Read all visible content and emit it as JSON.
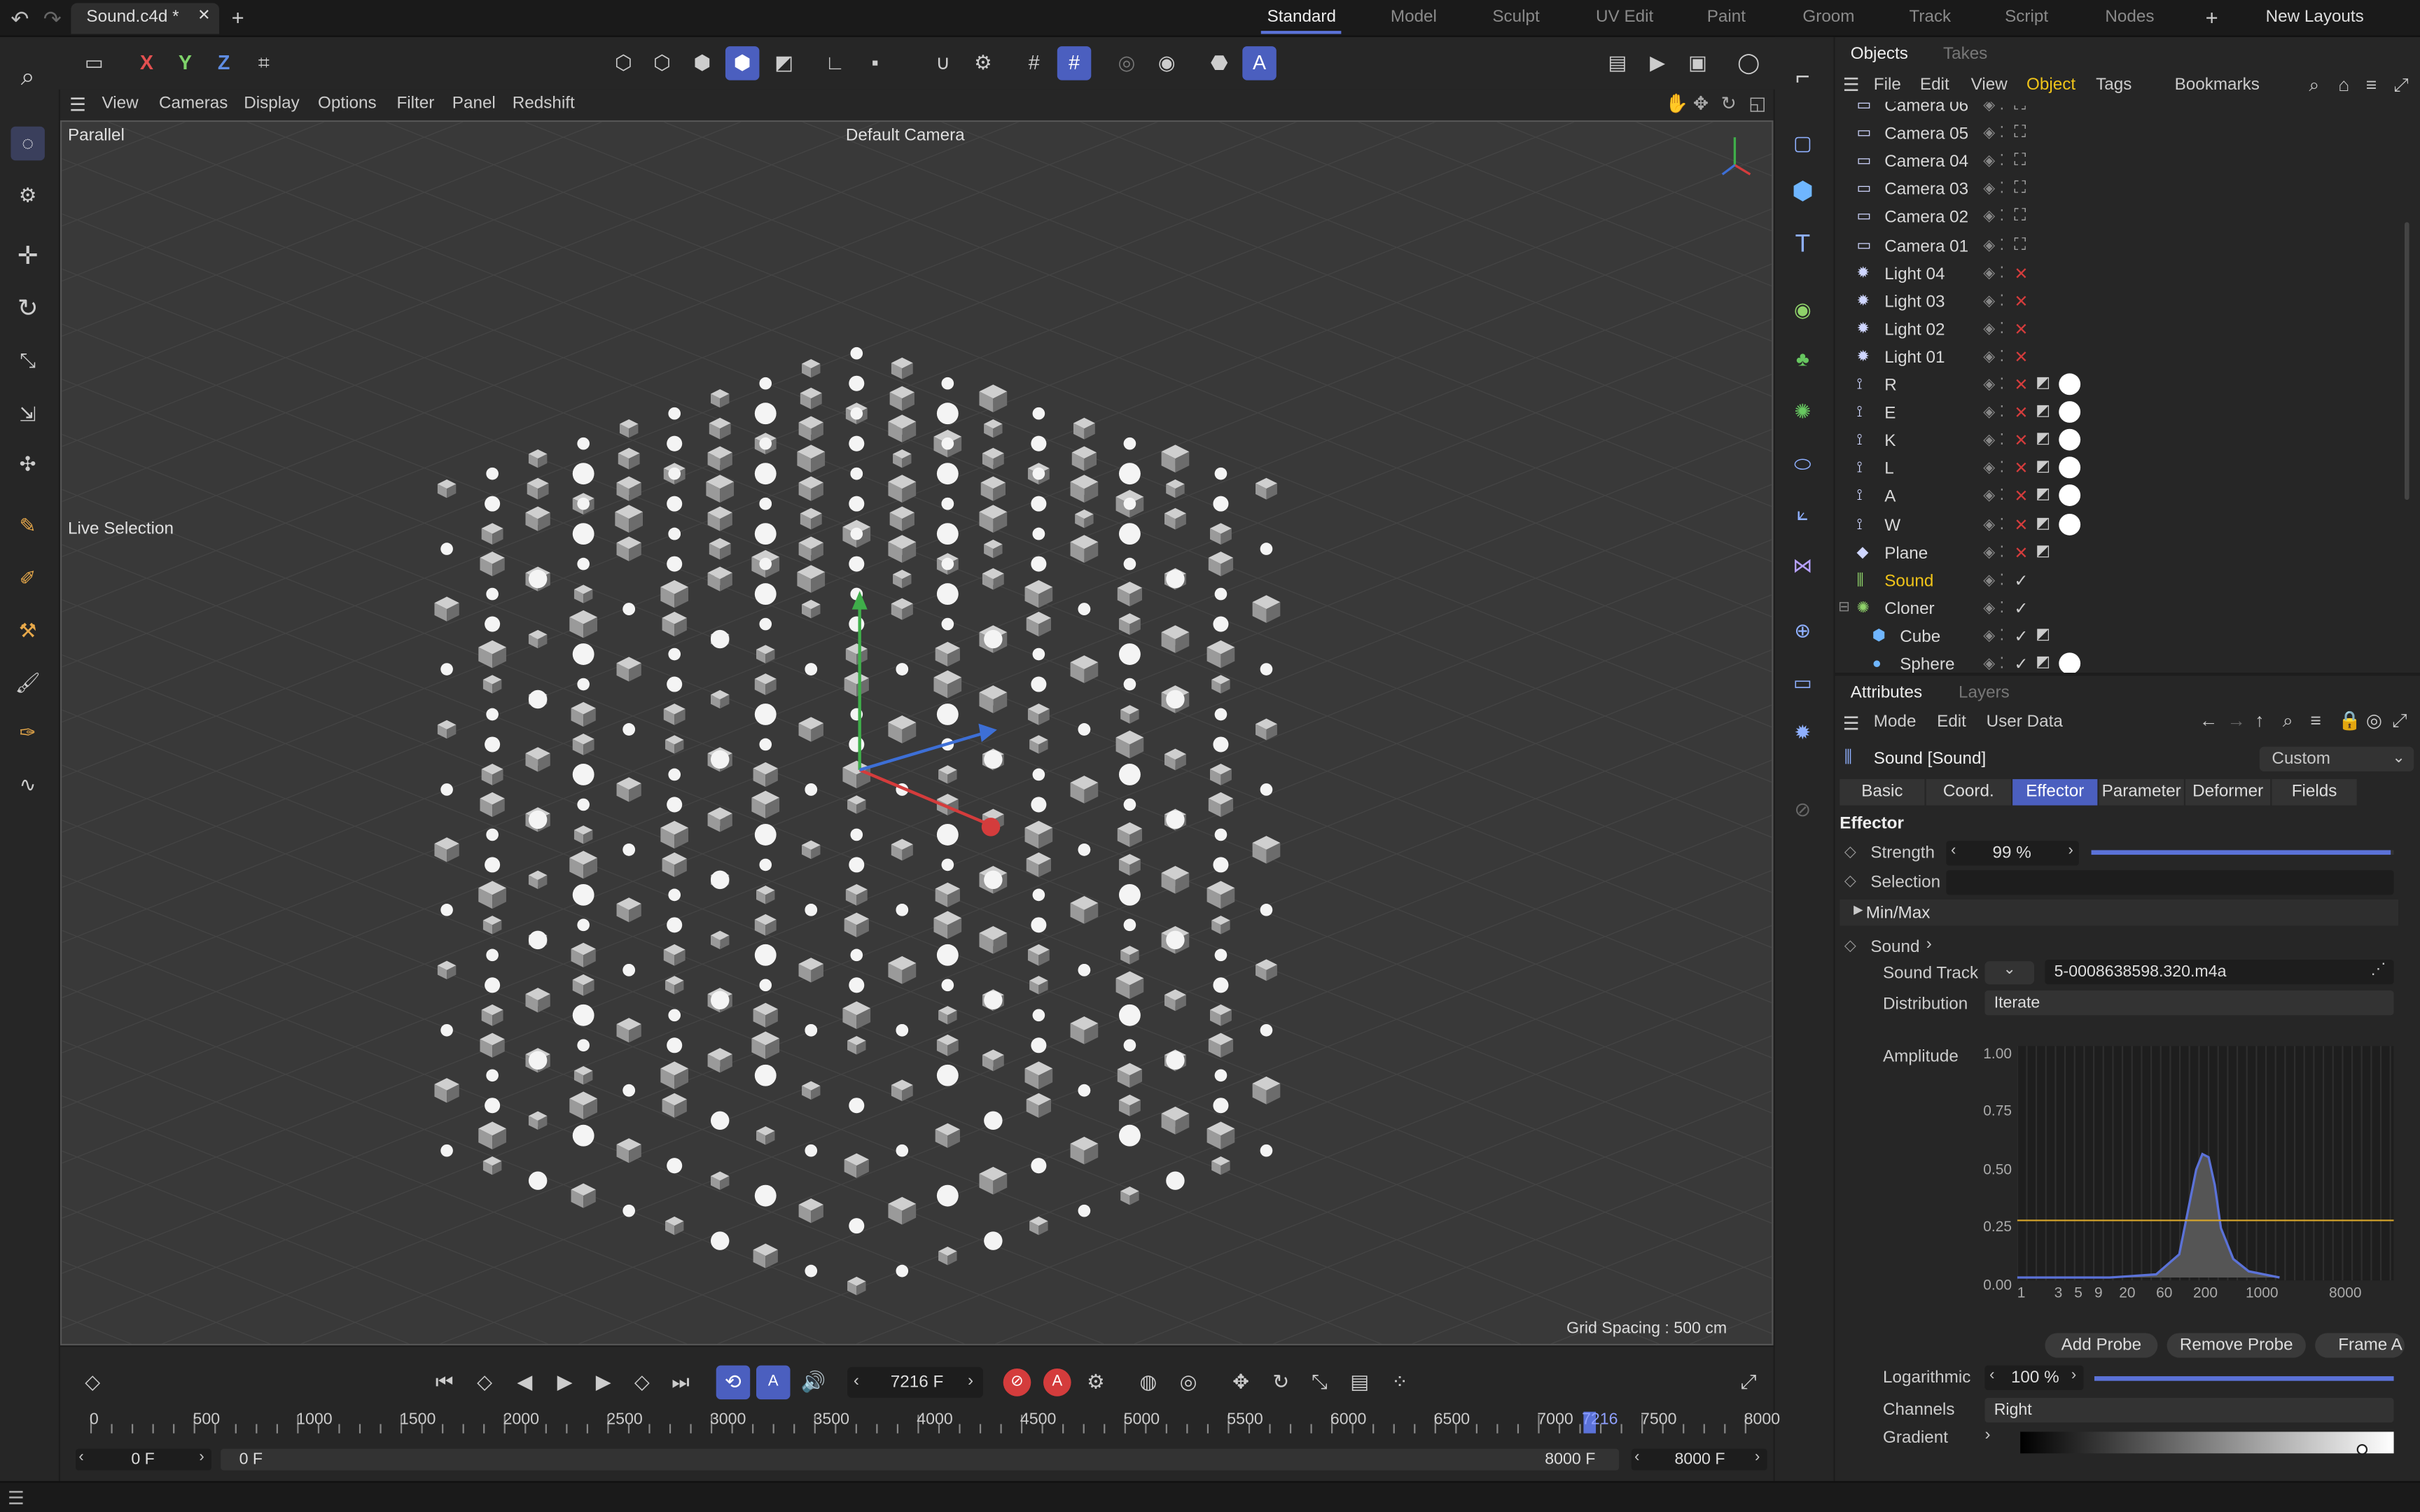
{
  "titlebar": {
    "doc_tab": "Sound.c4d *",
    "close": "✕",
    "plus": "+",
    "layouts": [
      "Standard",
      "Model",
      "Sculpt",
      "UV Edit",
      "Paint",
      "Groom",
      "Track",
      "Script",
      "Nodes"
    ],
    "active_layout": "Standard",
    "add": "+",
    "new_layouts": "New Layouts"
  },
  "toolbar": {
    "axes": [
      "X",
      "Y",
      "Z"
    ]
  },
  "viewport_menu": {
    "items": [
      "View",
      "Cameras",
      "Display",
      "Options",
      "Filter",
      "Panel",
      "Redshift"
    ]
  },
  "viewport": {
    "projection": "Parallel",
    "camera": "Default Camera",
    "tool": "Live Selection",
    "grid_spacing": "Grid Spacing : 500 cm"
  },
  "objects_panel": {
    "tabs": [
      "Objects",
      "Takes"
    ],
    "menu": [
      "File",
      "Edit",
      "View",
      "Object",
      "Tags",
      "Bookmarks"
    ],
    "active_menu": "Object",
    "rows": [
      {
        "name": "Camera 06",
        "type": "camera"
      },
      {
        "name": "Camera 05",
        "type": "camera"
      },
      {
        "name": "Camera 04",
        "type": "camera"
      },
      {
        "name": "Camera 03",
        "type": "camera"
      },
      {
        "name": "Camera 02",
        "type": "camera"
      },
      {
        "name": "Camera 01",
        "type": "camera"
      },
      {
        "name": "Light 04",
        "type": "light"
      },
      {
        "name": "Light 03",
        "type": "light"
      },
      {
        "name": "Light 02",
        "type": "light"
      },
      {
        "name": "Light 01",
        "type": "light"
      },
      {
        "name": "R",
        "type": "text"
      },
      {
        "name": "E",
        "type": "text"
      },
      {
        "name": "K",
        "type": "text"
      },
      {
        "name": "L",
        "type": "text"
      },
      {
        "name": "A",
        "type": "text"
      },
      {
        "name": "W",
        "type": "text"
      },
      {
        "name": "Plane",
        "type": "plane"
      },
      {
        "name": "Sound",
        "type": "sound",
        "selected": true
      },
      {
        "name": "Cloner",
        "type": "cloner"
      },
      {
        "name": "Cube",
        "type": "cube",
        "child": true
      },
      {
        "name": "Sphere",
        "type": "sphere",
        "child": true
      }
    ]
  },
  "attributes": {
    "tabs": [
      "Attributes",
      "Layers"
    ],
    "menu": [
      "Mode",
      "Edit",
      "User Data"
    ],
    "object_title": "Sound [Sound]",
    "preset": "Custom",
    "subtabs": [
      "Basic",
      "Coord.",
      "Effector",
      "Parameter",
      "Deformer",
      "Fields"
    ],
    "active_subtab": "Effector",
    "section": "Effector",
    "strength_label": "Strength",
    "strength_value": "99 %",
    "strength": 0.99,
    "selection_label": "Selection",
    "minmax_label": "Min/Max",
    "sound_label": "Sound",
    "sound_track_label": "Sound Track",
    "sound_track_value": "5-0008638598.320.m4a",
    "distribution_label": "Distribution",
    "distribution_value": "Iterate",
    "amplitude_label": "Amplitude",
    "y_ticks": [
      "1.00",
      "0.75",
      "0.50",
      "0.25",
      "0.00"
    ],
    "x_ticks": [
      "1",
      "3",
      "5",
      "9",
      "20",
      "60",
      "200",
      "1000",
      "8000"
    ],
    "add_probe": "Add Probe",
    "remove_probe": "Remove Probe",
    "frame_all": "Frame A",
    "log_label": "Logarithmic",
    "log_value": "100 %",
    "log": 1.0,
    "channels_label": "Channels",
    "channels_value": "Right",
    "gradient_label": "Gradient"
  },
  "timeline": {
    "frame_field": "7216 F",
    "ticks": [
      "0",
      "500",
      "1000",
      "1500",
      "2000",
      "2500",
      "3000",
      "3500",
      "4000",
      "4500",
      "5000",
      "5500",
      "6000",
      "6500",
      "7000",
      "7216",
      "7500",
      "8000"
    ],
    "current_frame": 7216,
    "start_field": "0 F",
    "range_start": "0 F",
    "range_end": "8000 F",
    "end_field": "8000 F"
  },
  "colors": {
    "accent": "#4b5fbf",
    "selected_text": "#f0c419",
    "red_x": "#d43c3c",
    "green_check": "#cccccc"
  }
}
